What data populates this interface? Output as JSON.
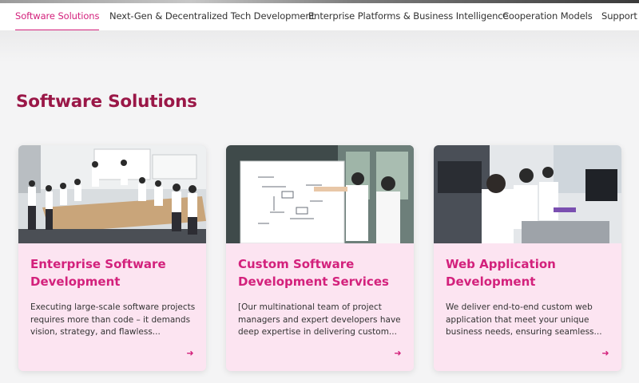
{
  "tabs": [
    {
      "label": "Software Solutions",
      "active": true
    },
    {
      "label": "Next-Gen & Decentralized Tech Development",
      "active": false
    },
    {
      "label": "Enterprise Platforms & Business Intelligence",
      "active": false
    },
    {
      "label": "Cooperation Models",
      "active": false
    },
    {
      "label": "Support &",
      "active": false
    }
  ],
  "section": {
    "title": "Software Solutions"
  },
  "cards": [
    {
      "title": "Enterprise Software Development",
      "description": "Executing large-scale software projects requires more than code – it demands vision, strategy, and flawless...",
      "arrow_icon": "arrow-right-icon"
    },
    {
      "title": "Custom Software Development Services",
      "description": "[Our multinational team of project managers and expert developers have deep expertise in delivering custom...",
      "arrow_icon": "arrow-right-icon"
    },
    {
      "title": "Web Application Development",
      "description": "We deliver end-to-end custom web application that meet your unique business needs, ensuring seamless...",
      "arrow_icon": "arrow-right-icon"
    }
  ],
  "colors": {
    "accent": "#d3217c",
    "heading": "#9a1747",
    "card_bg": "#fce4f1"
  }
}
